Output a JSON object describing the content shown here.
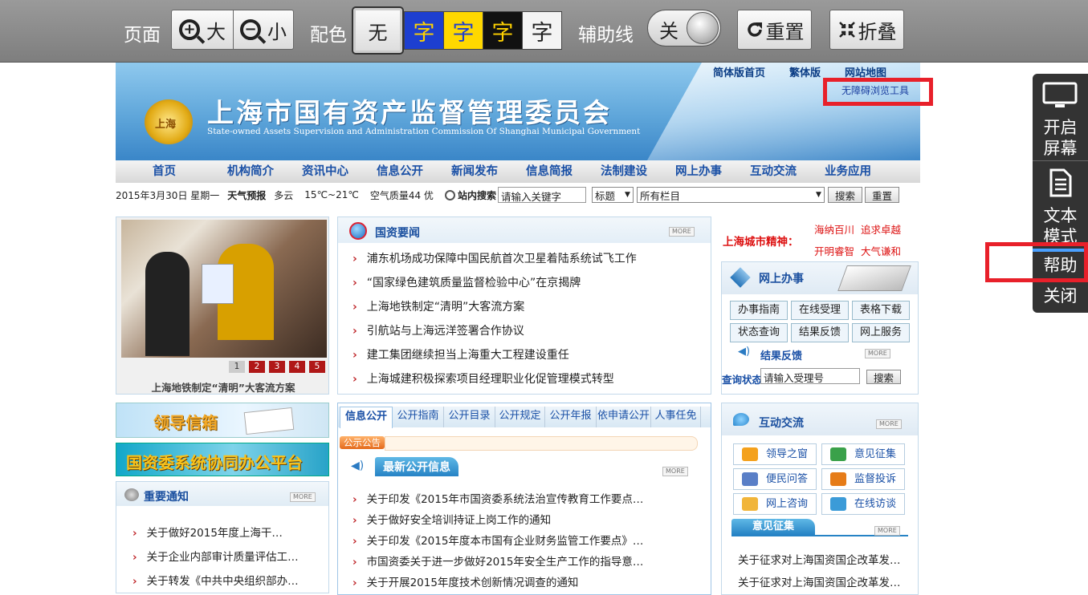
{
  "toolbar": {
    "page_label": "页面",
    "zoom_in": "大",
    "zoom_out": "小",
    "zoom_in_symbol": "+",
    "zoom_out_symbol": "−",
    "color_label": "配色",
    "color_none": "无",
    "color_swatches": [
      {
        "text": "字",
        "bg": "#1d3fd0",
        "fg": "#ffd200"
      },
      {
        "text": "字",
        "bg": "#ffd800",
        "fg": "#1d3fd0"
      },
      {
        "text": "字",
        "bg": "#111111",
        "fg": "#ffd200"
      },
      {
        "text": "字",
        "bg": "#f4f4f4",
        "fg": "#222222"
      }
    ],
    "guide_label": "辅助线",
    "guide_toggle": "关",
    "reset": "重置",
    "collapse": "折叠"
  },
  "side_panel": {
    "screen_reader": "开启\n屏幕",
    "text_mode": "文本\n模式",
    "help": "帮助",
    "close": "关闭"
  },
  "header": {
    "links": [
      "简体版首页",
      "繁体版",
      "网站地图"
    ],
    "a11y_tool": "无障碍浏览工具",
    "emblem": "上海",
    "title": "上海市国有资产监督管理委员会",
    "subtitle": "State-owned Assets Supervision and Administration Commission Of Shanghai Municipal Government"
  },
  "nav": [
    "首页",
    "机构简介",
    "资讯中心",
    "信息公开",
    "新闻发布",
    "信息简报",
    "法制建设",
    "网上办事",
    "互动交流",
    "业务应用"
  ],
  "infobar": {
    "date": "2015年3月30日 星期一",
    "weather_label": "天气预报",
    "weather": "多云",
    "temp": "15℃~21℃",
    "air": "空气质量44 优",
    "search_label": "站内搜索",
    "search_placeholder": "请输入关键字",
    "field_select": "标题",
    "column_select": "所有栏目",
    "search_btn": "搜索",
    "reset_btn": "重置"
  },
  "slideshow": {
    "caption": "上海地铁制定“清明”大客流方案",
    "pages": [
      "1",
      "2",
      "3",
      "4",
      "5"
    ]
  },
  "leader_mailbox": "领导信箱",
  "collab_platform": "国资委系统协同办公平台",
  "notices": {
    "title": "重要通知",
    "more": "MORE",
    "items": [
      "关于做好2015年度上海干…",
      "关于企业内部审计质量评估工…",
      "关于转发《中共中央组织部办…"
    ]
  },
  "news": {
    "title": "国资要闻",
    "more": "MORE",
    "items": [
      "浦东机场成功保障中国民航首次卫星着陆系统试飞工作",
      "“国家绿色建筑质量监督检验中心”在京揭牌",
      "上海地铁制定“清明”大客流方案",
      "引航站与上海远洋签署合作协议",
      "建工集团继续担当上海重大工程建设重任",
      "上海城建积极探索项目经理职业化促管理模式转型"
    ]
  },
  "disclosure": {
    "tabs": [
      "信息公开",
      "公开指南",
      "公开目录",
      "公开规定",
      "公开年报",
      "依申请公开",
      "人事任免"
    ],
    "notice_tag": "公示公告",
    "latest_title": "最新公开信息",
    "more": "MORE",
    "items": [
      "关于印发《2015年市国资委系统法治宣传教育工作要点…",
      "关于做好安全培训持证上岗工作的通知",
      "关于印发《2015年度本市国有企业财务监管工作要点》…",
      "市国资委关于进一步做好2015年安全生产工作的指导意…",
      "关于开展2015年度技术创新情况调查的通知"
    ]
  },
  "spirit": {
    "label": "上海城市精神：",
    "phrases": [
      "海纳百川",
      "追求卓越",
      "开明睿智",
      "大气谦和"
    ]
  },
  "online": {
    "title": "网上办事",
    "services": [
      "办事指南",
      "在线受理",
      "表格下载",
      "状态查询",
      "结果反馈",
      "网上服务"
    ],
    "feedback_title": "结果反馈",
    "more": "MORE",
    "status_label": "查询状态",
    "status_placeholder": "请输入受理号",
    "search_btn": "搜索"
  },
  "interaction": {
    "title": "互动交流",
    "more": "MORE",
    "items": [
      "领导之窗",
      "意见征集",
      "便民问答",
      "监督投诉",
      "网上咨询",
      "在线访谈"
    ],
    "opinion_title": "意见征集",
    "opinion_items": [
      "关于征求对上海国资国企改革发…",
      "关于征求对上海国资国企改革发…"
    ]
  }
}
